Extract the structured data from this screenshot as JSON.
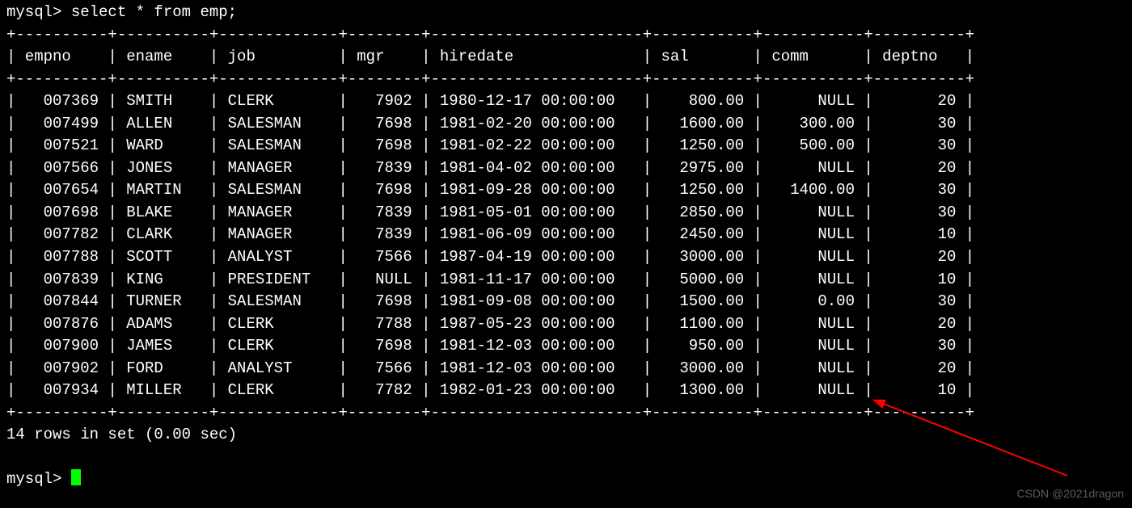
{
  "prompt1": "mysql> ",
  "query": "select * from emp;",
  "columns": [
    "empno",
    "ename",
    "job",
    "mgr",
    "hiredate",
    "sal",
    "comm",
    "deptno"
  ],
  "widths": [
    8,
    8,
    11,
    6,
    21,
    9,
    9,
    8
  ],
  "align": [
    "right",
    "left",
    "left",
    "right",
    "left",
    "right",
    "right",
    "right"
  ],
  "rows": [
    [
      "007369",
      "SMITH",
      "CLERK",
      "7902",
      "1980-12-17 00:00:00",
      "800.00",
      "NULL",
      "20"
    ],
    [
      "007499",
      "ALLEN",
      "SALESMAN",
      "7698",
      "1981-02-20 00:00:00",
      "1600.00",
      "300.00",
      "30"
    ],
    [
      "007521",
      "WARD",
      "SALESMAN",
      "7698",
      "1981-02-22 00:00:00",
      "1250.00",
      "500.00",
      "30"
    ],
    [
      "007566",
      "JONES",
      "MANAGER",
      "7839",
      "1981-04-02 00:00:00",
      "2975.00",
      "NULL",
      "20"
    ],
    [
      "007654",
      "MARTIN",
      "SALESMAN",
      "7698",
      "1981-09-28 00:00:00",
      "1250.00",
      "1400.00",
      "30"
    ],
    [
      "007698",
      "BLAKE",
      "MANAGER",
      "7839",
      "1981-05-01 00:00:00",
      "2850.00",
      "NULL",
      "30"
    ],
    [
      "007782",
      "CLARK",
      "MANAGER",
      "7839",
      "1981-06-09 00:00:00",
      "2450.00",
      "NULL",
      "10"
    ],
    [
      "007788",
      "SCOTT",
      "ANALYST",
      "7566",
      "1987-04-19 00:00:00",
      "3000.00",
      "NULL",
      "20"
    ],
    [
      "007839",
      "KING",
      "PRESIDENT",
      "NULL",
      "1981-11-17 00:00:00",
      "5000.00",
      "NULL",
      "10"
    ],
    [
      "007844",
      "TURNER",
      "SALESMAN",
      "7698",
      "1981-09-08 00:00:00",
      "1500.00",
      "0.00",
      "30"
    ],
    [
      "007876",
      "ADAMS",
      "CLERK",
      "7788",
      "1987-05-23 00:00:00",
      "1100.00",
      "NULL",
      "20"
    ],
    [
      "007900",
      "JAMES",
      "CLERK",
      "7698",
      "1981-12-03 00:00:00",
      "950.00",
      "NULL",
      "30"
    ],
    [
      "007902",
      "FORD",
      "ANALYST",
      "7566",
      "1981-12-03 00:00:00",
      "3000.00",
      "NULL",
      "20"
    ],
    [
      "007934",
      "MILLER",
      "CLERK",
      "7782",
      "1982-01-23 00:00:00",
      "1300.00",
      "NULL",
      "10"
    ]
  ],
  "summary": "14 rows in set (0.00 sec)",
  "prompt2": "mysql> ",
  "watermark": "CSDN @2021dragon"
}
